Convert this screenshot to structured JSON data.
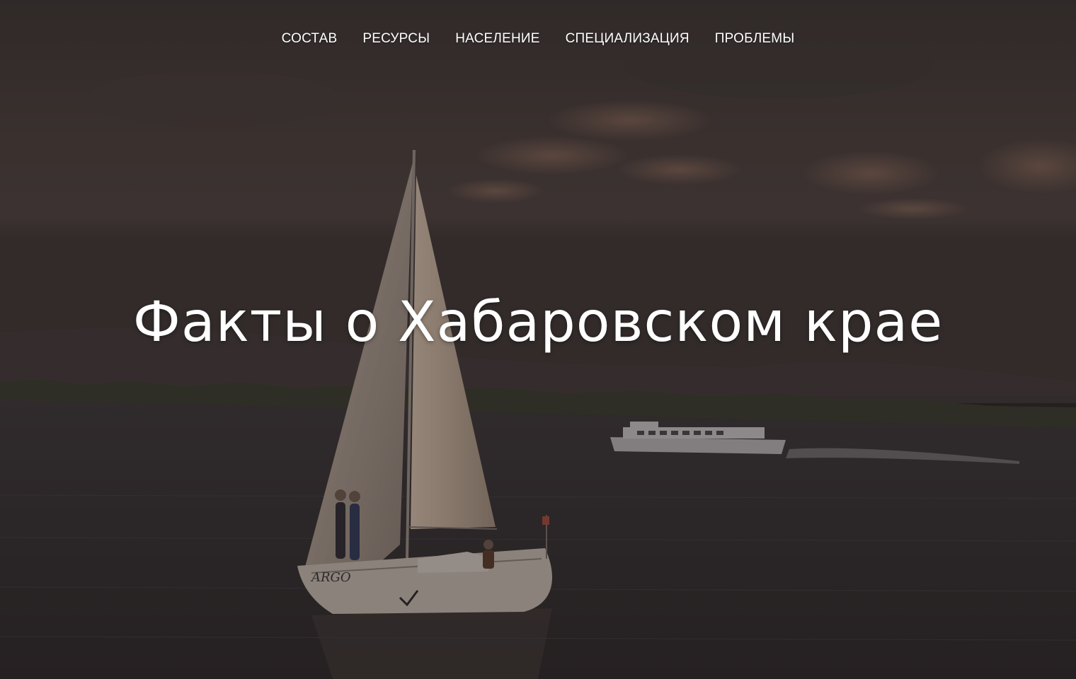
{
  "nav": {
    "items": [
      {
        "label": "СОСТАВ"
      },
      {
        "label": "РЕСУРСЫ"
      },
      {
        "label": "НАСЕЛЕНИЕ"
      },
      {
        "label": "СПЕЦИАЛИЗАЦИЯ"
      },
      {
        "label": "ПРОБЛЕМЫ"
      }
    ]
  },
  "hero": {
    "title": "Факты о Хабаровском крае",
    "overlay_color": "#1c1817"
  },
  "boat": {
    "hull_name": "ARGO"
  }
}
